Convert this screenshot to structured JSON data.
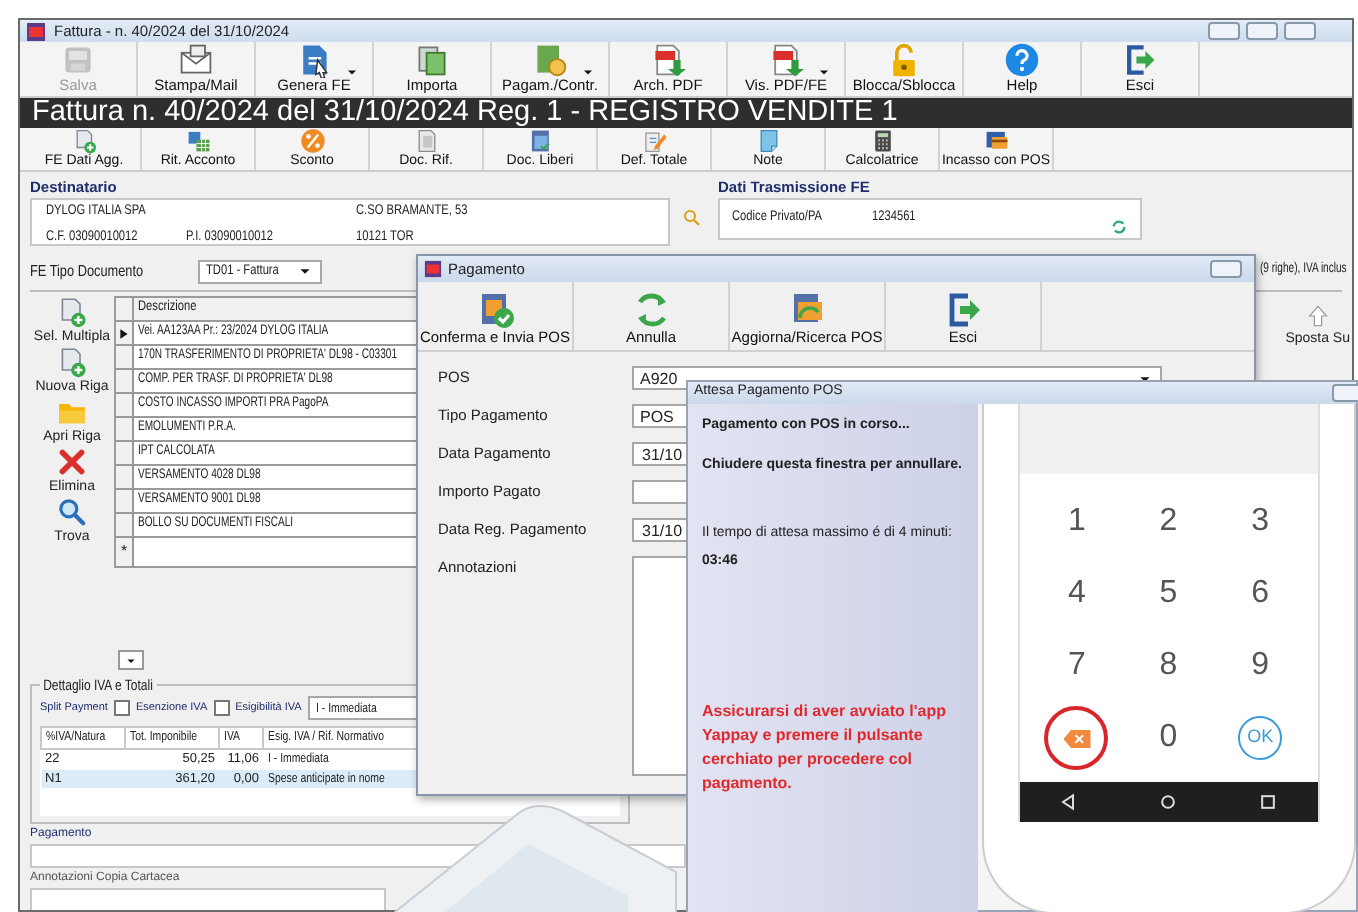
{
  "window": {
    "title": "Fattura - n. 40/2024 del 31/10/2024"
  },
  "toolbar": [
    {
      "label": "Salva",
      "disabled": true,
      "dropdown": false
    },
    {
      "label": "Stampa/Mail",
      "disabled": false,
      "dropdown": false
    },
    {
      "label": "Genera FE",
      "disabled": false,
      "dropdown": true
    },
    {
      "label": "Importa",
      "disabled": false,
      "dropdown": false
    },
    {
      "label": "Pagam./Contr.",
      "disabled": false,
      "dropdown": true
    },
    {
      "label": "Arch. PDF",
      "disabled": false,
      "dropdown": false
    },
    {
      "label": "Vis. PDF/FE",
      "disabled": false,
      "dropdown": true
    },
    {
      "label": "Blocca/Sblocca",
      "disabled": false,
      "dropdown": false
    },
    {
      "label": "Help",
      "disabled": false,
      "dropdown": false
    },
    {
      "label": "Esci",
      "disabled": false,
      "dropdown": false
    }
  ],
  "banner": "Fattura n. 40/2024 del 31/10/2024 Reg. 1 - REGISTRO VENDITE 1",
  "toolbar2": [
    "FE Dati Agg.",
    "Rit. Acconto",
    "Sconto",
    "Doc. Rif.",
    "Doc. Liberi",
    "Def. Totale",
    "Note",
    "Calcolatrice",
    "Incasso con POS"
  ],
  "recipient": {
    "heading": "Destinatario",
    "name": "DYLOG ITALIA SPA",
    "address": "C.SO BRAMANTE, 53",
    "tax_code": "C.F. 03090010012",
    "vat_number": "P.I. 03090010012",
    "city": "10121 TOR"
  },
  "transmission": {
    "heading": "Dati Trasmissione FE",
    "label": "Codice Privato/PA",
    "value": "1234561"
  },
  "doc_type": {
    "label": "FE Tipo Documento",
    "value": "TD01 - Fattura"
  },
  "row_tools": [
    "Sel. Multipla",
    "Nuova Riga",
    "Apri Riga",
    "Elimina",
    "Trova"
  ],
  "lines": {
    "header": "Descrizione",
    "rows": [
      {
        "kind": "current",
        "text": "Vei. AA123AA Pr.: 23/2024 DYLOG ITALIA"
      },
      {
        "kind": "line",
        "text": "170N TRASFERIMENTO DI PROPRIETA' DL98 - C03301"
      },
      {
        "kind": "line",
        "text": "COMP. PER TRASF. DI PROPRIETA' DL98"
      },
      {
        "kind": "line",
        "text": "COSTO INCASSO IMPORTI PRA PagoPA"
      },
      {
        "kind": "line",
        "text": "EMOLUMENTI P.R.A."
      },
      {
        "kind": "line",
        "text": "IPT CALCOLATA"
      },
      {
        "kind": "line",
        "text": "VERSAMENTO 4028 DL98"
      },
      {
        "kind": "line",
        "text": "VERSAMENTO 9001 DL98"
      },
      {
        "kind": "line",
        "text": "BOLLO SU DOCUMENTI FISCALI"
      },
      {
        "kind": "new",
        "text": "*"
      }
    ]
  },
  "side_panel": {
    "summary": "(9 righe), IVA inclus",
    "move_up": "Sposta Su"
  },
  "vat": {
    "heading": "Dettaglio IVA e Totali",
    "split_payment": {
      "label": "Split Payment",
      "checked": false
    },
    "exemption": {
      "label": "Esenzione IVA",
      "checked": false
    },
    "eligibility": {
      "label": "Esigibilità IVA",
      "value": "I - Immediata"
    },
    "columns": [
      "%IVA/Natura",
      "Tot. Imponibile",
      "IVA",
      "Esig. IVA / Rif. Normativo"
    ],
    "rows": [
      {
        "cells": [
          "22",
          "50,25",
          "11,06",
          "I - Immediata"
        ],
        "selected": false
      },
      {
        "cells": [
          "N1",
          "361,20",
          "0,00",
          "Spese anticipate in nome"
        ],
        "selected": true
      }
    ]
  },
  "payment": {
    "label": "Pagamento"
  },
  "notes": {
    "label": "Annotazioni Copia Cartacea"
  },
  "payment_dialog": {
    "title": "Pagamento",
    "toolbar": [
      "Conferma e Invia POS",
      "Annulla",
      "Aggiorna/Ricerca POS",
      "Esci"
    ],
    "fields": [
      {
        "kind": "select",
        "label": "POS",
        "value": "A920"
      },
      {
        "kind": "text",
        "label": "Tipo Pagamento",
        "value": "POS"
      },
      {
        "kind": "date",
        "label": "Data Pagamento",
        "value": "31/10"
      },
      {
        "kind": "text",
        "label": "Importo Pagato"
      },
      {
        "kind": "date",
        "label": "Data Reg. Pagamento",
        "value": "31/10"
      },
      {
        "kind": "textarea",
        "label": "Annotazioni"
      }
    ]
  },
  "pos_dialog": {
    "title": "Attesa Pagamento POS",
    "status": "Pagamento con POS in corso...",
    "cancel_hint": "Chiudere questa finestra per annullare.",
    "timeout": "Il tempo di attesa massimo é di 4 minuti:",
    "countdown": "03:46",
    "warning": "Assicurarsi di aver avviato l'app Yappay e premere il pulsante cerchiato per procedere col pagamento.",
    "keypad": [
      {
        "kind": "digit",
        "label": "1"
      },
      {
        "kind": "digit",
        "label": "2"
      },
      {
        "kind": "digit",
        "label": "3"
      },
      {
        "kind": "digit",
        "label": "4"
      },
      {
        "kind": "digit",
        "label": "5"
      },
      {
        "kind": "digit",
        "label": "6"
      },
      {
        "kind": "digit",
        "label": "7"
      },
      {
        "kind": "digit",
        "label": "8"
      },
      {
        "kind": "digit",
        "label": "9"
      },
      {
        "kind": "delete",
        "circled": true
      },
      {
        "kind": "digit",
        "label": "0"
      },
      {
        "kind": "ok",
        "label": "OK"
      }
    ]
  }
}
